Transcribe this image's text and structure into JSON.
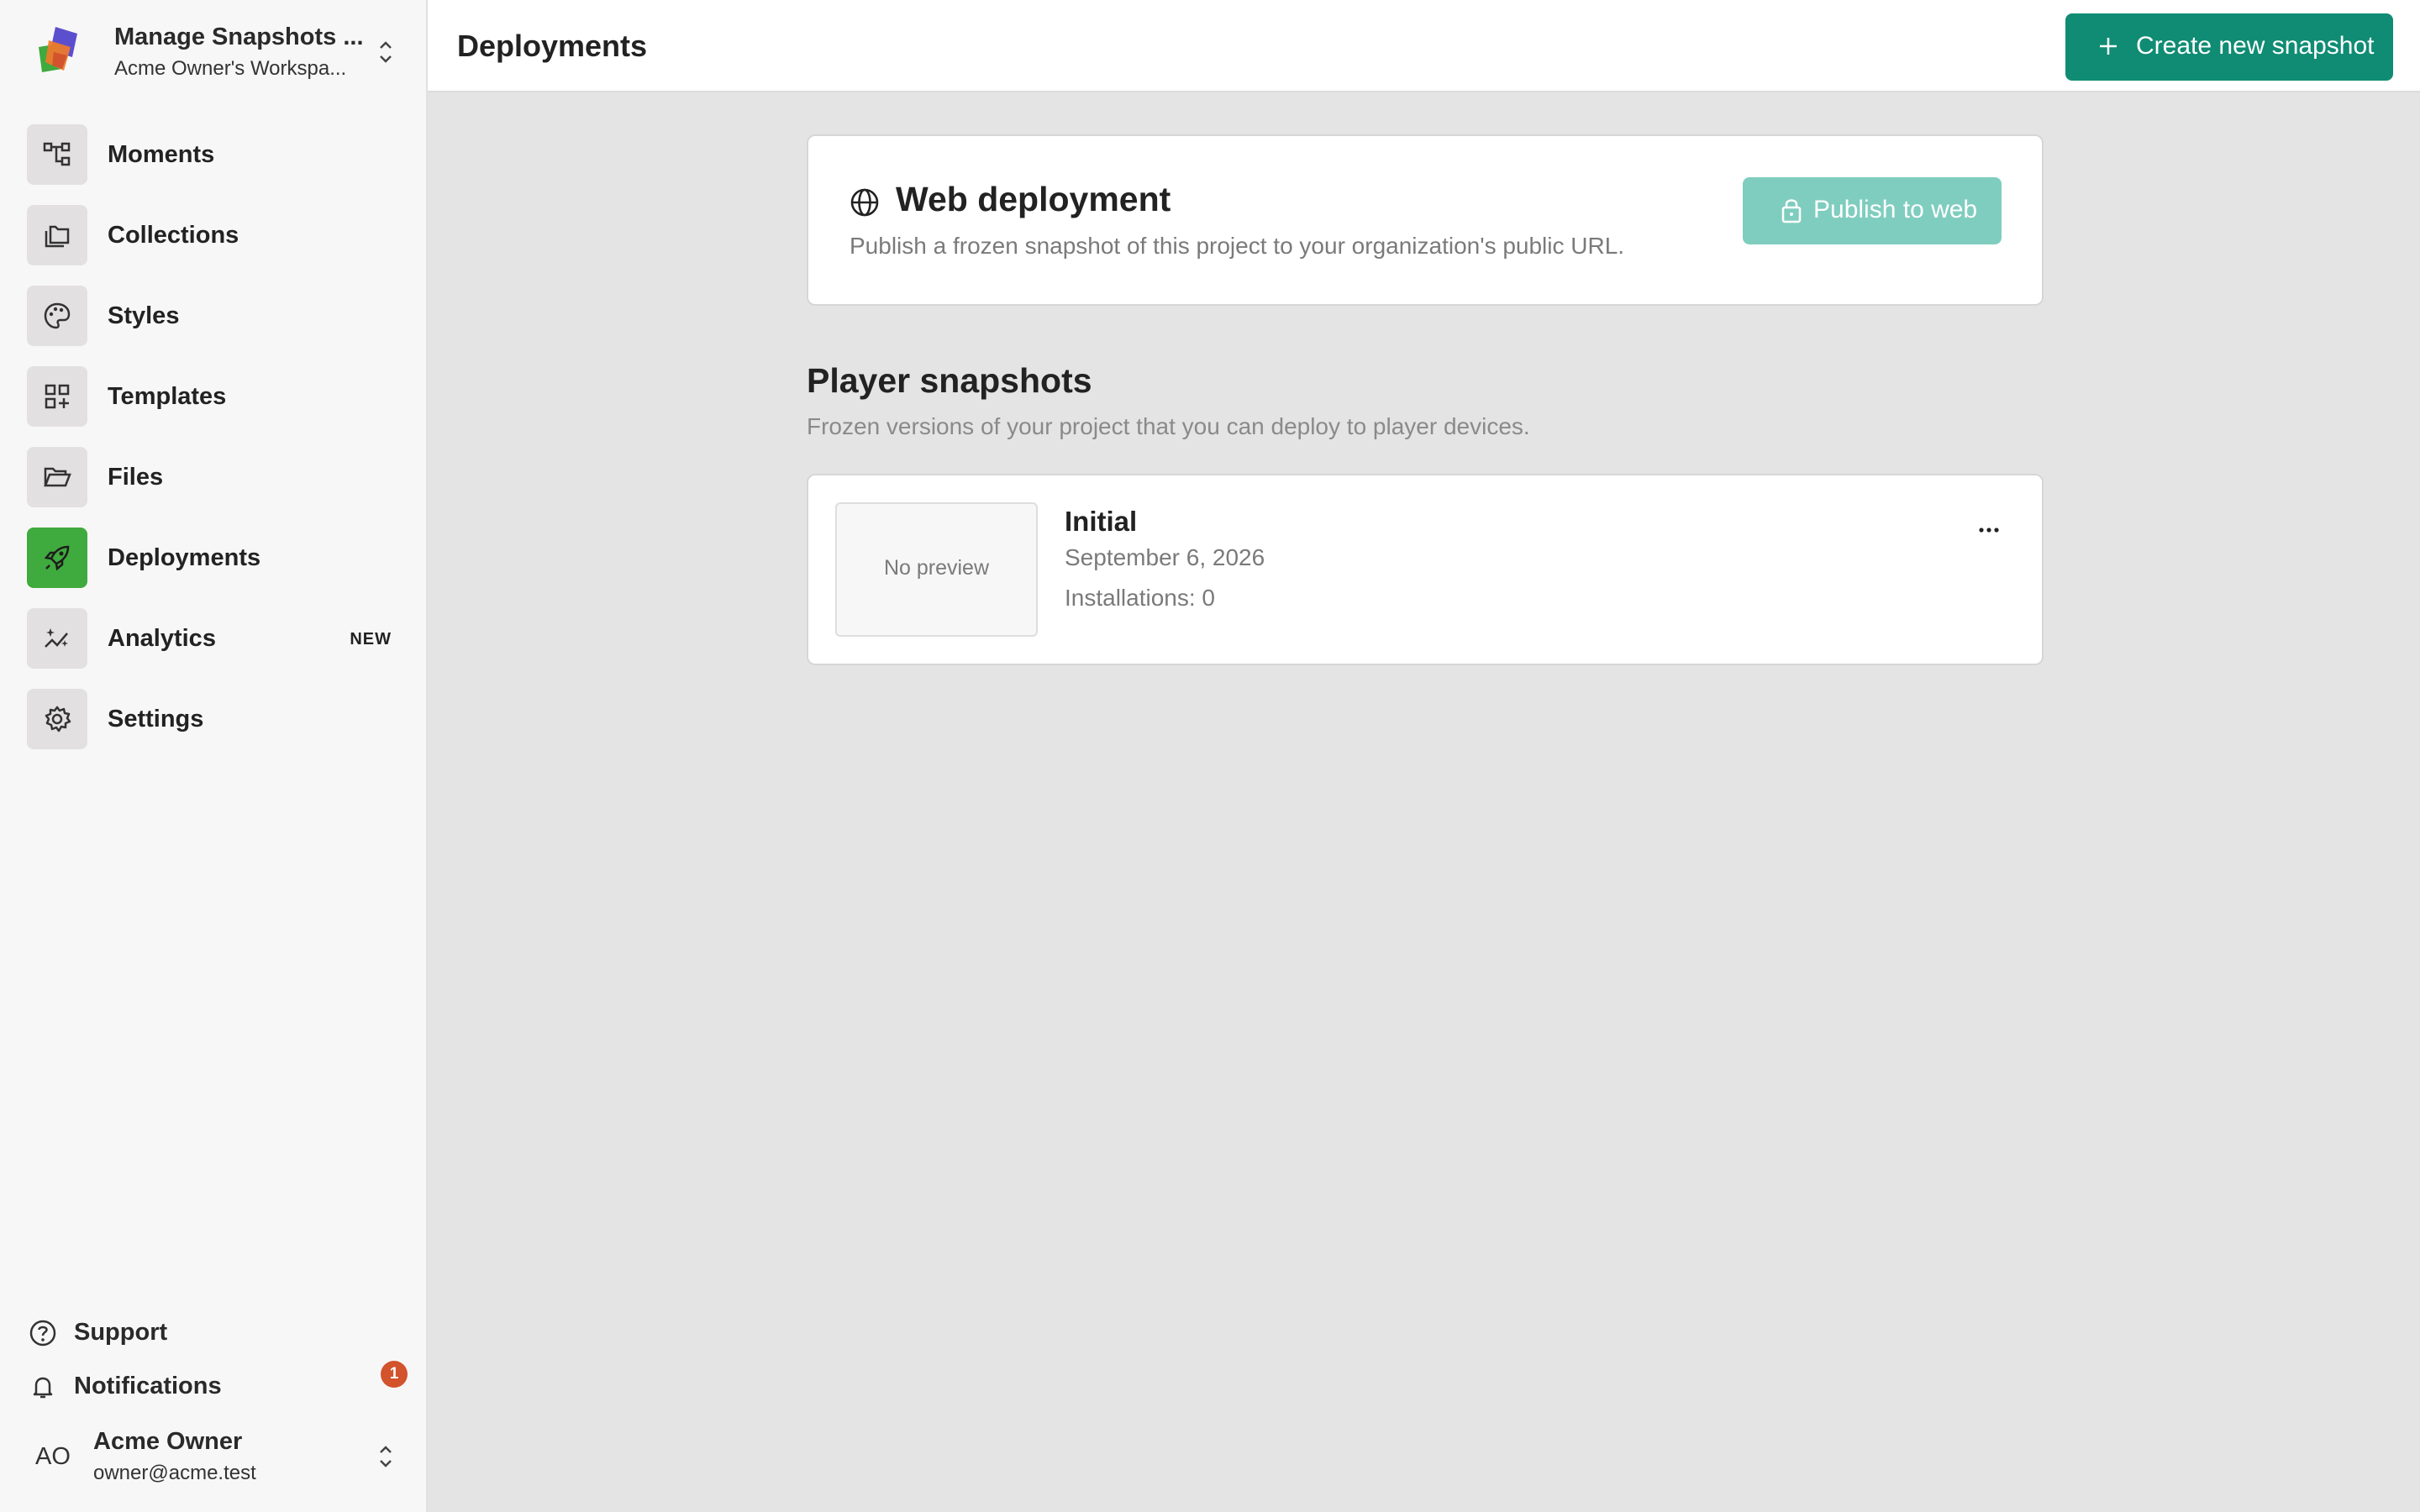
{
  "workspace": {
    "project_name": "Manage Snapshots ...",
    "workspace_name": "Acme Owner's Workspa..."
  },
  "sidebar": {
    "items": [
      {
        "label": "Moments",
        "icon": "moments-tree-icon",
        "active": false
      },
      {
        "label": "Collections",
        "icon": "collections-icon",
        "active": false
      },
      {
        "label": "Styles",
        "icon": "palette-icon",
        "active": false
      },
      {
        "label": "Templates",
        "icon": "templates-grid-icon",
        "active": false
      },
      {
        "label": "Files",
        "icon": "folder-open-icon",
        "active": false
      },
      {
        "label": "Deployments",
        "icon": "rocket-icon",
        "active": true
      },
      {
        "label": "Analytics",
        "icon": "analytics-sparkle-icon",
        "active": false,
        "badge": "NEW"
      },
      {
        "label": "Settings",
        "icon": "gear-icon",
        "active": false
      }
    ],
    "footer": {
      "support": "Support",
      "notifications": "Notifications",
      "notification_count": "1"
    },
    "user": {
      "initials": "AO",
      "name": "Acme Owner",
      "email": "owner@acme.test"
    }
  },
  "header": {
    "title": "Deployments",
    "create_button": "Create new snapshot"
  },
  "web_deployment": {
    "title": "Web deployment",
    "description": "Publish a frozen snapshot of this project to your organization's public URL.",
    "publish_button": "Publish to web"
  },
  "player_snapshots": {
    "title": "Player snapshots",
    "description": "Frozen versions of your project that you can deploy to player devices.",
    "items": [
      {
        "preview": "No preview",
        "name": "Initial",
        "date": "September 6, 2026",
        "installations": "Installations: 0"
      }
    ]
  },
  "colors": {
    "accent": "#0f8c73",
    "accent_disabled": "#7fcdbf",
    "active_nav": "#3faa3d",
    "notification": "#d2532c"
  }
}
